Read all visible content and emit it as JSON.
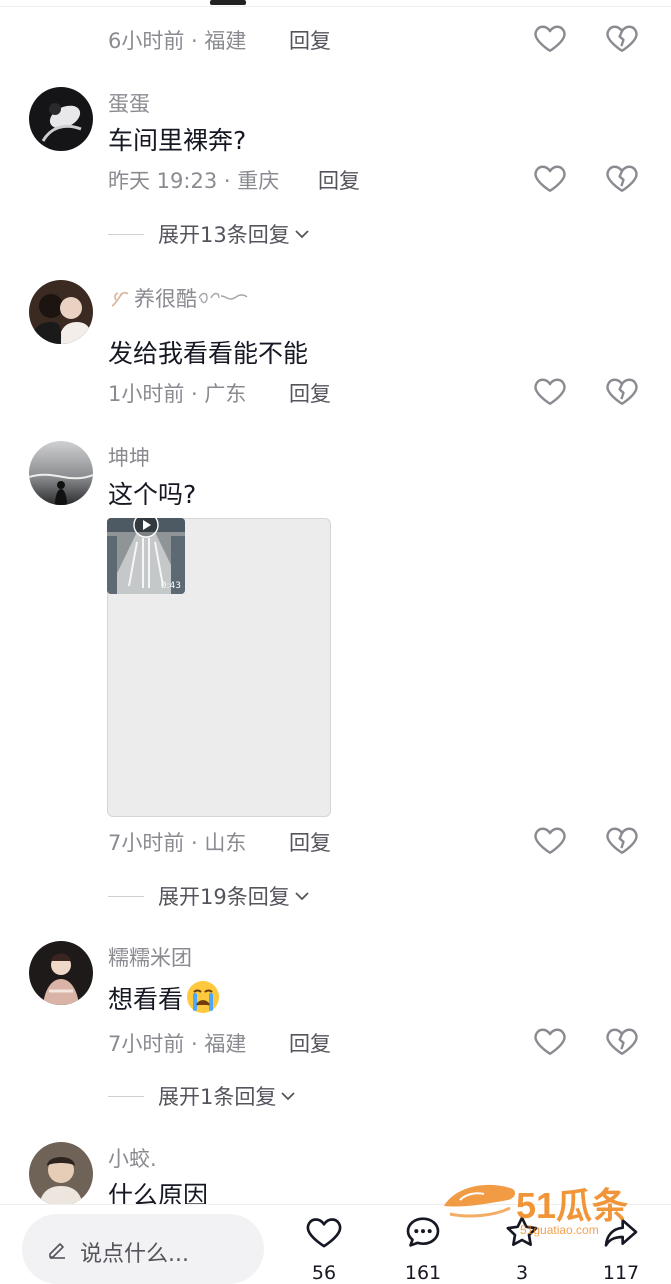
{
  "comments": [
    {
      "meta": "6小时前 · 福建",
      "reply": "回复"
    },
    {
      "name": "蛋蛋",
      "text": "车间里裸奔?",
      "meta": "昨天 19:23 · 重庆",
      "reply": "回复",
      "expand": "展开13条回复"
    },
    {
      "name": "养很酷",
      "text": "发给我看看能不能",
      "meta": "1小时前 · 广东",
      "reply": "回复"
    },
    {
      "name": "坤坤",
      "text": "这个吗?",
      "media_duration": "0:43",
      "meta": "7小时前 · 山东",
      "reply": "回复",
      "expand": "展开19条回复"
    },
    {
      "name": "糯糯米团",
      "text": "想看看",
      "meta": "7小时前 · 福建",
      "reply": "回复",
      "expand": "展开1条回复"
    },
    {
      "name": "小蛟.",
      "text": "什么原因"
    }
  ],
  "bottom": {
    "input_placeholder": "说点什么...",
    "actions": [
      {
        "icon": "heart-icon",
        "count": "56"
      },
      {
        "icon": "comment-icon",
        "count": "161"
      },
      {
        "icon": "star-icon",
        "count": "3"
      },
      {
        "icon": "share-icon",
        "count": "117"
      }
    ]
  },
  "watermark": {
    "brand": "51瓜条",
    "domain": "51guatiao.com"
  },
  "colors": {
    "secondary_text": "#8a8b91",
    "primary_text": "#161823",
    "watermark": "#f08a24"
  }
}
